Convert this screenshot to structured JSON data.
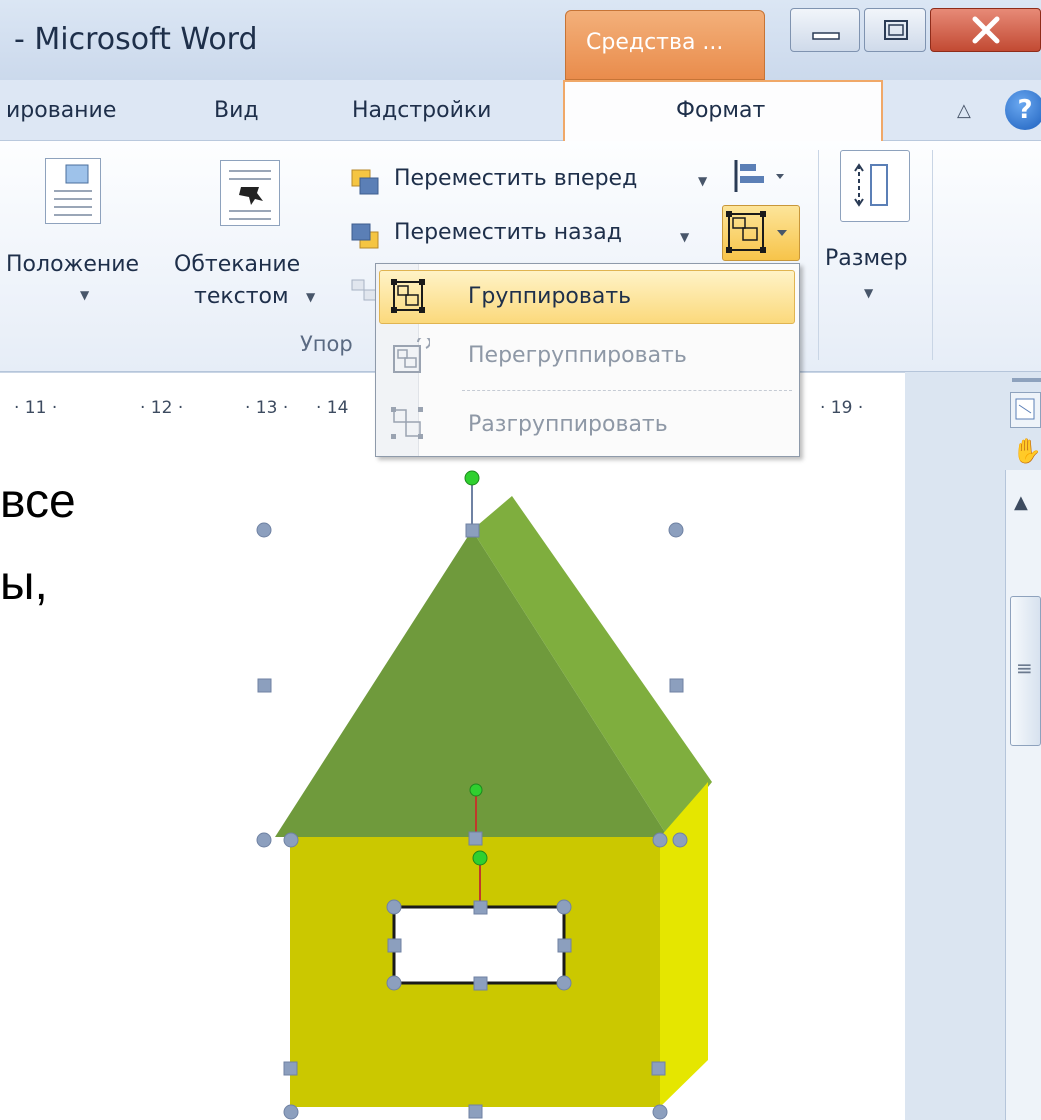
{
  "window": {
    "title": "- Microsoft Word",
    "context_tab": "Средства ..."
  },
  "tabs": {
    "items": [
      "ирование",
      "Вид",
      "Надстройки"
    ],
    "active": "Формат"
  },
  "ribbon": {
    "position_label": "Положение",
    "wrap_label_1": "Обтекание",
    "wrap_label_2": "текстом",
    "bring_forward": "Переместить вперед",
    "send_backward": "Переместить назад",
    "size_label": "Размер",
    "group_label": "Упор"
  },
  "ruler": {
    "marks": [
      "· 11 ·",
      "· 12 ·",
      "· 13 ·",
      "· 14",
      "· 19 ·"
    ]
  },
  "menu": {
    "items": [
      {
        "label": "Группировать",
        "enabled": true
      },
      {
        "label": "Перегруппировать",
        "enabled": false
      },
      {
        "label": "Разгруппировать",
        "enabled": false
      }
    ]
  },
  "document": {
    "line1": "все",
    "line2": "ы,"
  },
  "colors": {
    "roof_front": "#6f9a3c",
    "roof_side": "#7fae3e",
    "house_front": "#cbc800",
    "house_side": "#e5e600",
    "handle": "#8c9fbe",
    "rotate_handle": "#2fd02f",
    "highlight": "#fbd97c"
  }
}
